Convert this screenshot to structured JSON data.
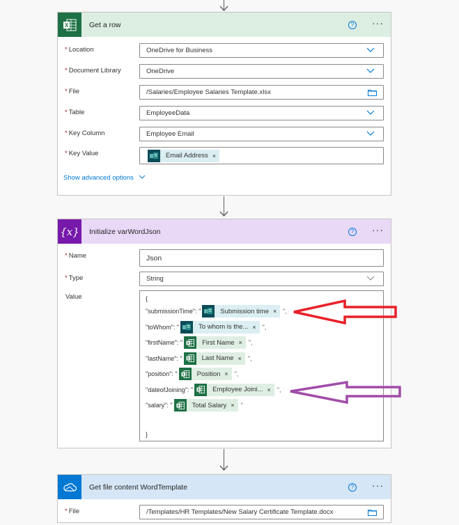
{
  "colors": {
    "excel_green": "#1e7145",
    "excel_header_bg": "#dceee2",
    "variable_purple": "#7719aa",
    "variable_header_bg": "#e9d9f7",
    "onedrive_blue": "#0078d4",
    "onedrive_header_bg": "#d5e6f6",
    "forms_teal": "#0b4c57",
    "link_blue": "#0078d4",
    "required_red": "#a4262c",
    "annotation_red": "#e8202a",
    "annotation_purple": "#a04ca8"
  },
  "cards": {
    "get_row": {
      "title": "Get a row",
      "icon": "excel-icon",
      "help_icon": "?",
      "more_icon": "···",
      "fields": [
        {
          "label": "Location",
          "required_mark": "*",
          "value": "OneDrive for Business",
          "control": "dropdown"
        },
        {
          "label": "Document Library",
          "required_mark": "*",
          "value": "OneDrive",
          "control": "dropdown"
        },
        {
          "label": "File",
          "required_mark": "*",
          "value": "/Salaries/Employee Salaries Template.xlsx",
          "control": "file-picker"
        },
        {
          "label": "Table",
          "required_mark": "*",
          "value": "EmployeeData",
          "control": "dropdown"
        },
        {
          "label": "Key Column",
          "required_mark": "*",
          "value": "Employee Email",
          "control": "dropdown"
        },
        {
          "label": "Key Value",
          "required_mark": "*",
          "token": {
            "label": "Email Address",
            "source": "forms",
            "remove": "×"
          },
          "control": "token-input"
        }
      ],
      "advanced_link": "Show advanced options"
    },
    "init_var": {
      "title": "Initialize varWordJson",
      "icon": "variable-icon",
      "icon_glyph": "{x}",
      "help_icon": "?",
      "more_icon": "···",
      "name_label": "Name",
      "name_value": "Json",
      "type_label": "Type",
      "type_value": "String",
      "value_label": "Value",
      "required_mark": "*",
      "json_open": "{",
      "json_close": "}",
      "json_lines": [
        {
          "key": "\"submissionTime\": \"",
          "token": "Submission time",
          "source": "forms",
          "suffix": "\",",
          "remove": "×"
        },
        {
          "key": "\"toWhom\": \"",
          "token": "To whom is the...",
          "source": "forms",
          "suffix": "\",",
          "remove": "×"
        },
        {
          "key": "\"firstName\": \"",
          "token": "First Name",
          "source": "excel",
          "suffix": "\",",
          "remove": "×"
        },
        {
          "key": "\"lastName\": \"",
          "token": "Last Name",
          "source": "excel",
          "suffix": "\",",
          "remove": "×"
        },
        {
          "key": "\"position\": \"",
          "token": "Position",
          "source": "excel",
          "suffix": "\",",
          "remove": "×"
        },
        {
          "key": "\"dateofJoining\": \"",
          "token": "Employee Joini...",
          "source": "excel",
          "suffix": "\",",
          "remove": "×"
        },
        {
          "key": "\"salary\": \"",
          "token": "Total Salary",
          "source": "excel",
          "suffix": "\"",
          "remove": "×"
        }
      ]
    },
    "get_file": {
      "title": "Get file content WordTemplate",
      "icon": "onedrive-icon",
      "help_icon": "?",
      "more_icon": "···",
      "file_label": "File",
      "required_mark": "*",
      "file_value": "/Templates/HR Templates/New Salary Certificate Template.docx"
    }
  }
}
